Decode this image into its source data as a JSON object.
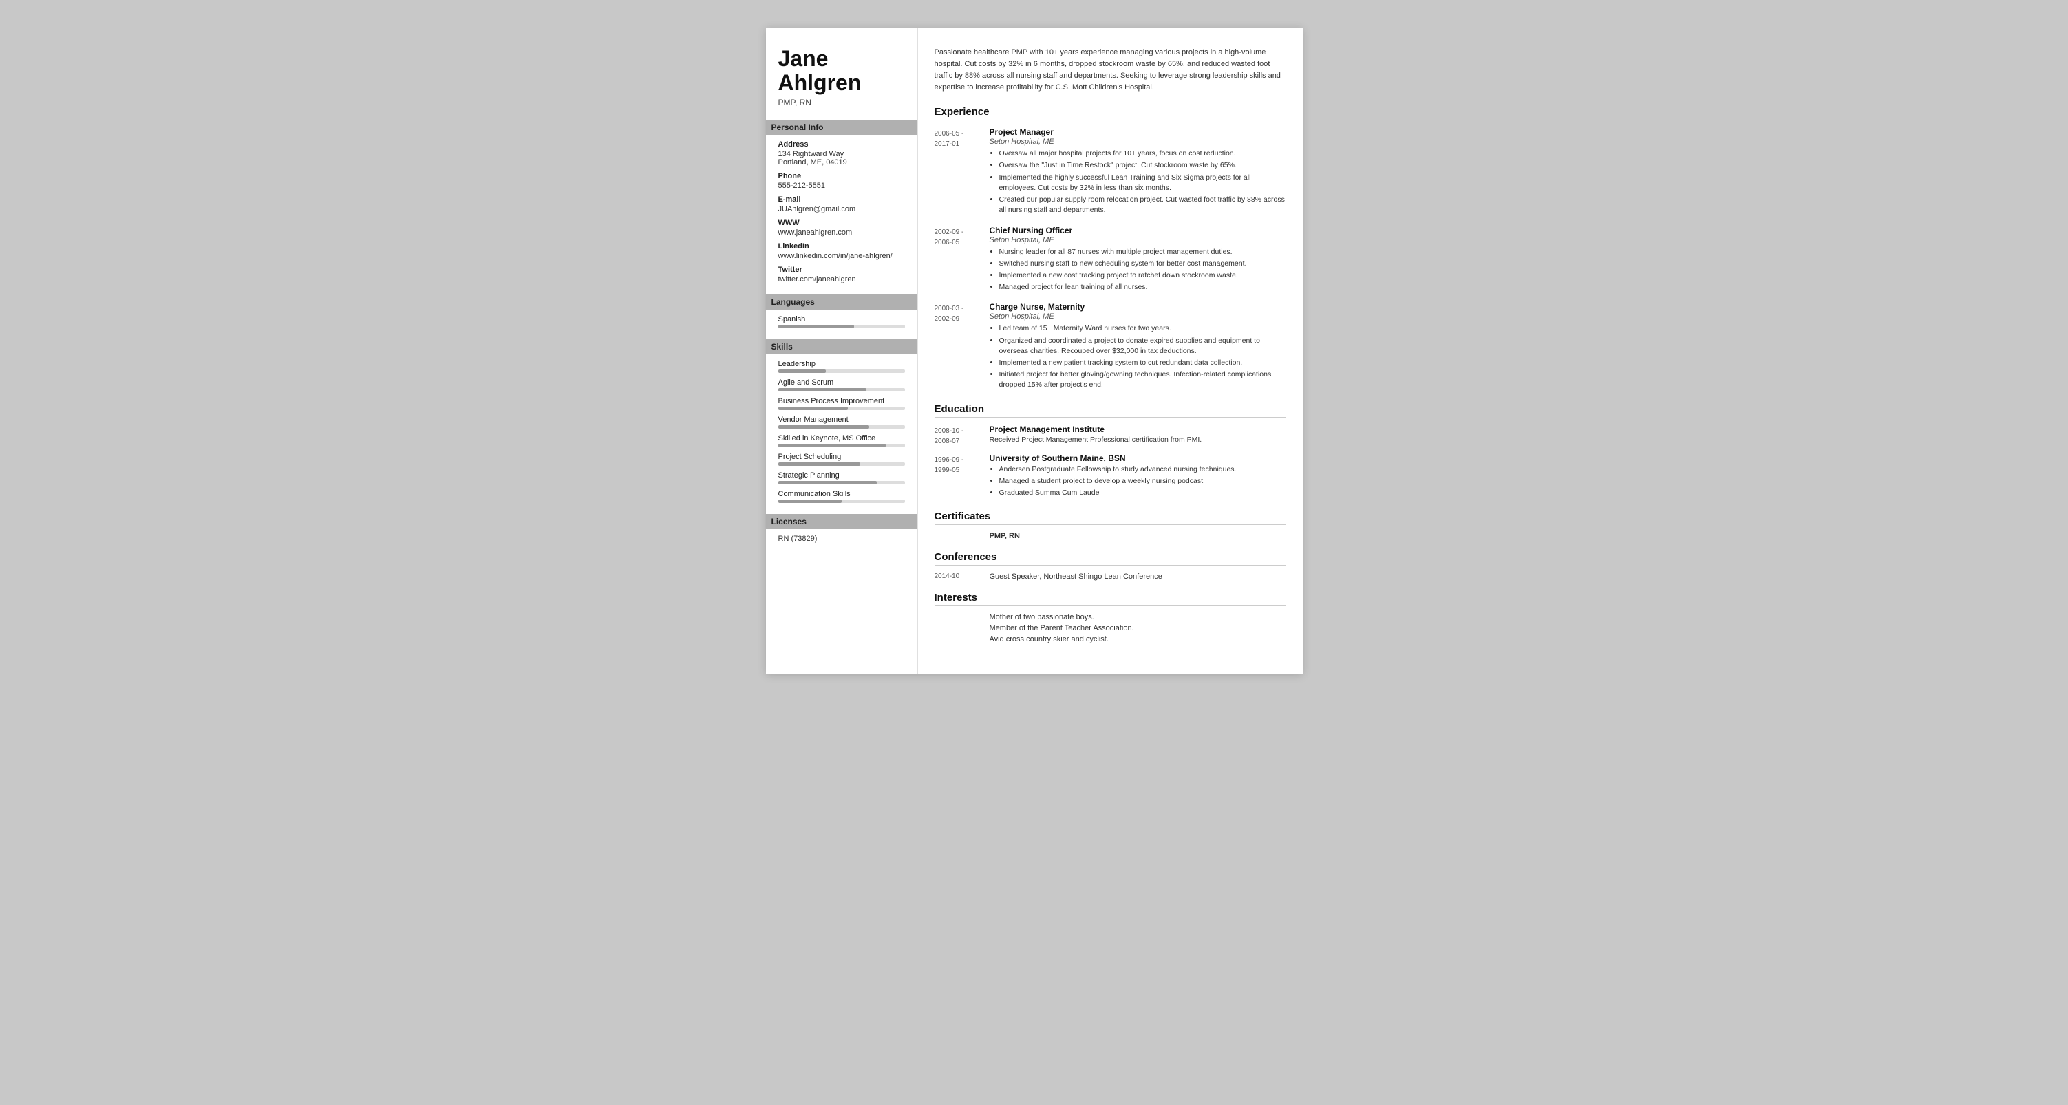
{
  "sidebar": {
    "name": "Jane\nAhlgren",
    "name_line1": "Jane",
    "name_line2": "Ahlgren",
    "title": "PMP, RN",
    "sections": {
      "personal_info": {
        "label": "Personal Info",
        "fields": [
          {
            "key": "Address",
            "value": "134 Rightward Way\nPortland, ME, 04019"
          },
          {
            "key": "Phone",
            "value": "555-212-5551"
          },
          {
            "key": "E-mail",
            "value": "JUAhlgren@gmail.com"
          },
          {
            "key": "WWW",
            "value": "www.janeahlgren.com"
          },
          {
            "key": "LinkedIn",
            "value": "www.linkedin.com/in/jane-ahlgren/"
          },
          {
            "key": "Twitter",
            "value": "twitter.com/janeahlgren"
          }
        ]
      },
      "languages": {
        "label": "Languages",
        "items": [
          {
            "name": "Spanish",
            "pct": 60
          }
        ]
      },
      "skills": {
        "label": "Skills",
        "items": [
          {
            "name": "Leadership",
            "pct": 38
          },
          {
            "name": "Agile and Scrum",
            "pct": 70
          },
          {
            "name": "Business Process Improvement",
            "pct": 55
          },
          {
            "name": "Vendor Management",
            "pct": 72
          },
          {
            "name": "Skilled in Keynote, MS Office",
            "pct": 85
          },
          {
            "name": "Project Scheduling",
            "pct": 65
          },
          {
            "name": "Strategic Planning",
            "pct": 78
          },
          {
            "name": "Communication Skills",
            "pct": 50
          }
        ]
      },
      "licenses": {
        "label": "Licenses",
        "items": [
          {
            "value": "RN (73829)"
          }
        ]
      }
    }
  },
  "main": {
    "summary": "Passionate healthcare PMP with 10+ years experience managing various projects in a high-volume hospital. Cut costs by 32% in 6 months, dropped stockroom waste by 65%, and reduced wasted foot traffic by 88% across all nursing staff and departments. Seeking to leverage strong leadership skills and expertise to increase profitability for C.S. Mott Children's Hospital.",
    "sections": {
      "experience": {
        "label": "Experience",
        "entries": [
          {
            "dates": "2006-05 -\n2017-01",
            "title": "Project Manager",
            "company": "Seton Hospital, ME",
            "bullets": [
              "Oversaw all major hospital projects for 10+ years, focus on cost reduction.",
              "Oversaw the \"Just in Time Restock\" project. Cut stockroom waste by 65%.",
              "Implemented the highly successful Lean Training and Six Sigma projects for all employees. Cut costs by 32% in less than six months.",
              "Created our popular supply room relocation project. Cut wasted foot traffic by 88% across all nursing staff and departments."
            ]
          },
          {
            "dates": "2002-09 -\n2006-05",
            "title": "Chief Nursing Officer",
            "company": "Seton Hospital, ME",
            "bullets": [
              "Nursing leader for all 87 nurses with multiple project management duties.",
              "Switched nursing staff to new scheduling system for better cost management.",
              "Implemented a new cost tracking project to ratchet down stockroom waste.",
              "Managed project for lean training of all nurses."
            ]
          },
          {
            "dates": "2000-03 -\n2002-09",
            "title": "Charge Nurse, Maternity",
            "company": "Seton Hospital, ME",
            "bullets": [
              "Led team of 15+ Maternity Ward nurses for two years.",
              "Organized and coordinated a project to donate expired supplies and equipment to overseas charities. Recouped over $32,000 in tax deductions.",
              "Implemented a new patient tracking system to cut redundant data collection.",
              "Initiated project for better gloving/gowning techniques. Infection-related complications dropped 15% after project's end."
            ]
          }
        ]
      },
      "education": {
        "label": "Education",
        "entries": [
          {
            "dates": "2008-10 -\n2008-07",
            "school": "Project Management Institute",
            "desc": "Received Project Management Professional certification from PMI.",
            "bullets": []
          },
          {
            "dates": "1996-09 -\n1999-05",
            "school": "University of Southern Maine, BSN",
            "desc": "",
            "bullets": [
              "Andersen Postgraduate Fellowship to study advanced nursing techniques.",
              "Managed a student project to develop a weekly nursing podcast.",
              "Graduated Summa Cum Laude"
            ]
          }
        ]
      },
      "certificates": {
        "label": "Certificates",
        "entries": [
          {
            "dates": "",
            "value": "PMP, RN"
          }
        ]
      },
      "conferences": {
        "label": "Conferences",
        "entries": [
          {
            "dates": "2014-10",
            "value": "Guest Speaker, Northeast Shingo Lean Conference"
          }
        ]
      },
      "interests": {
        "label": "Interests",
        "entries": [
          {
            "value": "Mother of two passionate boys."
          },
          {
            "value": "Member of the Parent Teacher Association."
          },
          {
            "value": "Avid cross country skier and cyclist."
          }
        ]
      }
    }
  }
}
